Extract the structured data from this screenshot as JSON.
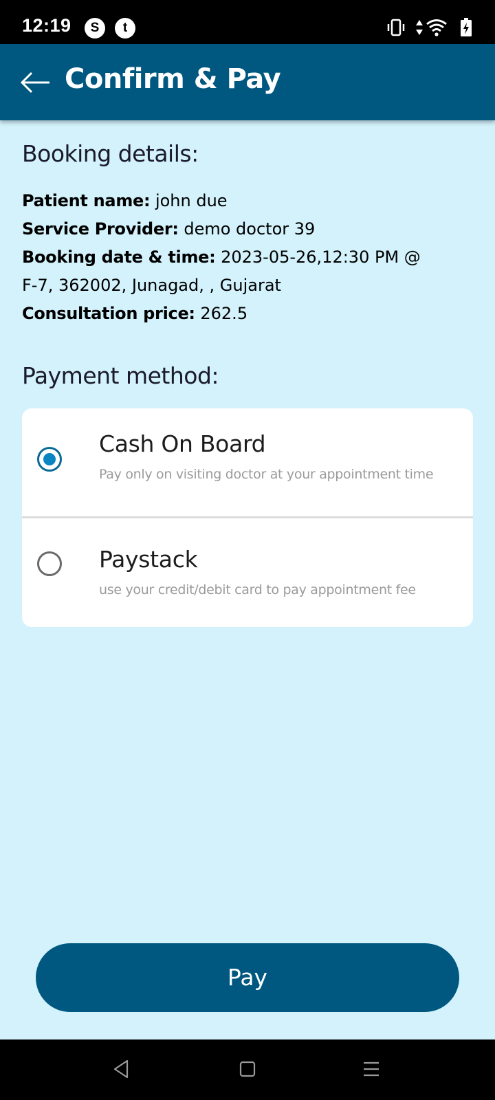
{
  "status_bar": {
    "time": "12:19",
    "app_icons": [
      "skype-icon",
      "tumblr-icon"
    ],
    "system_icons": [
      "vibrate-icon",
      "data-arrows-icon",
      "wifi-icon",
      "battery-charging-icon"
    ]
  },
  "app_bar": {
    "title": "Confirm & Pay",
    "back_icon": "arrow-left-icon"
  },
  "booking": {
    "heading": "Booking details:",
    "patient_label": "Patient name:",
    "patient_value": "john due",
    "provider_label": "Service Provider:",
    "provider_value": "demo doctor 39",
    "datetime_label": "Booking date & time:",
    "datetime_value": "2023-05-26,12:30 PM @",
    "address_value": "F-7, 362002, Junagad, , Gujarat",
    "price_label": "Consultation price:",
    "price_value": "262.5"
  },
  "payment": {
    "heading": "Payment method:",
    "options": [
      {
        "title": "Cash On Board",
        "subtitle": "Pay only on visiting doctor at your appointment time",
        "selected": true
      },
      {
        "title": "Paystack",
        "subtitle": "use your credit/debit card to pay appointment fee",
        "selected": false
      }
    ]
  },
  "pay_button": {
    "label": "Pay"
  },
  "nav_bar": {
    "icons": [
      "back-triangle-icon",
      "home-square-icon",
      "recents-menu-icon"
    ]
  },
  "colors": {
    "primary": "#005880",
    "background": "#d3f2fb",
    "radio_selected": "#0a85c2",
    "subtitle_text": "#9a9a9a"
  }
}
